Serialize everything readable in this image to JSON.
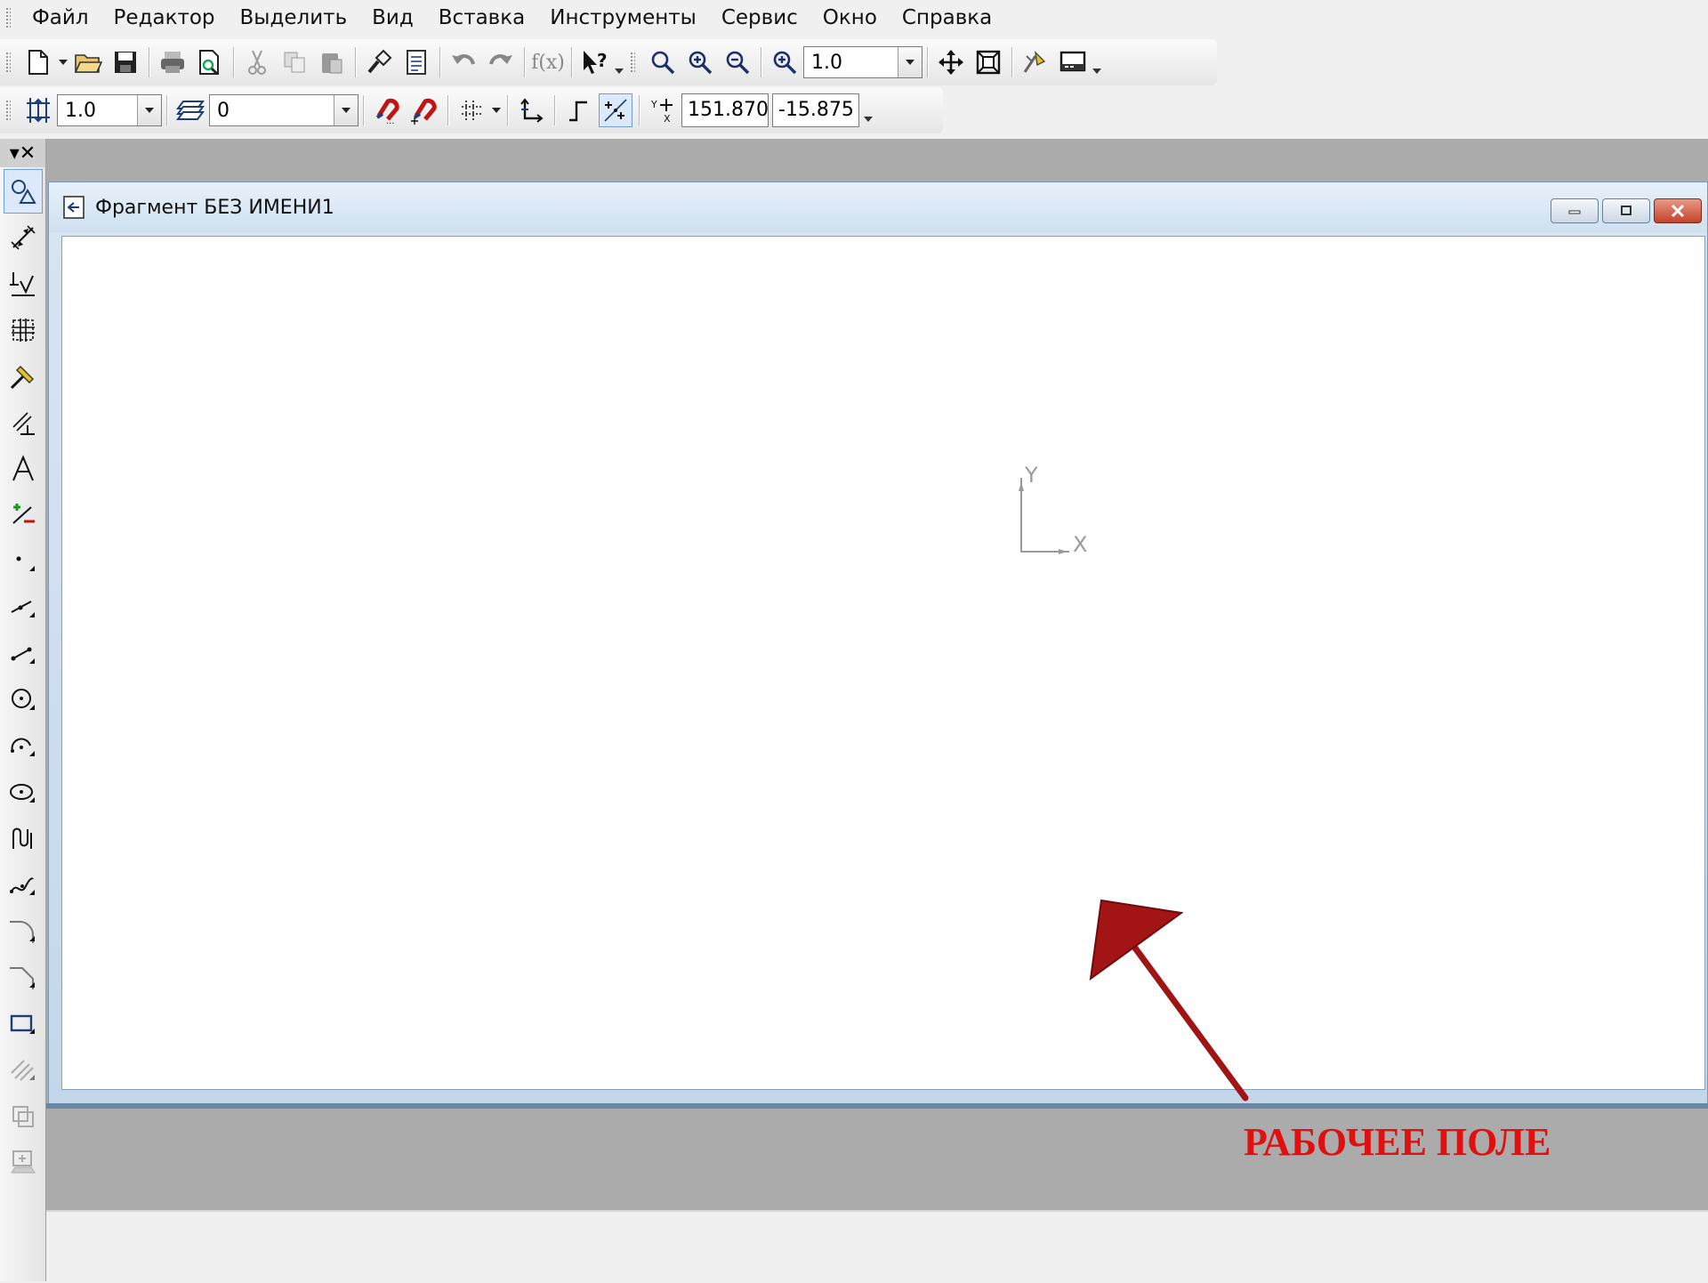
{
  "menu": {
    "items": [
      "Файл",
      "Редактор",
      "Выделить",
      "Вид",
      "Вставка",
      "Инструменты",
      "Сервис",
      "Окно",
      "Справка"
    ]
  },
  "toolbar_standard": {
    "zoom_value": "1.0",
    "icons": [
      "new-document-icon",
      "open-folder-icon",
      "save-icon",
      "print-icon",
      "print-preview-icon",
      "cut-icon",
      "copy-icon",
      "paste-icon",
      "format-brush-icon",
      "properties-icon",
      "undo-icon",
      "redo-icon",
      "function-icon",
      "context-help-icon",
      "zoom-window-icon",
      "zoom-in-icon",
      "zoom-out-icon",
      "zoom-scale-icon",
      "pan-icon",
      "zoom-all-icon",
      "regenerate-icon",
      "display-icon"
    ]
  },
  "toolbar_current_state": {
    "step_value": "1.0",
    "layer_value": "0",
    "coord_x": "151.870",
    "coord_y": "-15.875"
  },
  "left_toolbar": {
    "icons": [
      "geometry-icon",
      "dimensions-icon",
      "notation-icon",
      "edit-icon",
      "parametrization-icon",
      "measure-icon",
      "select-icon",
      "macro-elements-icon",
      "point-icon",
      "auxiliary-line-icon",
      "segment-icon",
      "circle-icon",
      "arc-icon",
      "ellipse-icon",
      "nurbs-icon",
      "bezier-icon",
      "fillet-icon",
      "chamfer-icon",
      "rectangle-icon",
      "hatch-icon",
      "equidistant-icon",
      "collect-contour-icon"
    ]
  },
  "document": {
    "title": "Фрагмент БЕЗ ИМЕНИ1",
    "axis_x": "X",
    "axis_y": "Y"
  },
  "annotation": {
    "label": "РАБОЧЕЕ ПОЛЕ",
    "color": "#e01010",
    "arrow_color": "#a01414"
  }
}
